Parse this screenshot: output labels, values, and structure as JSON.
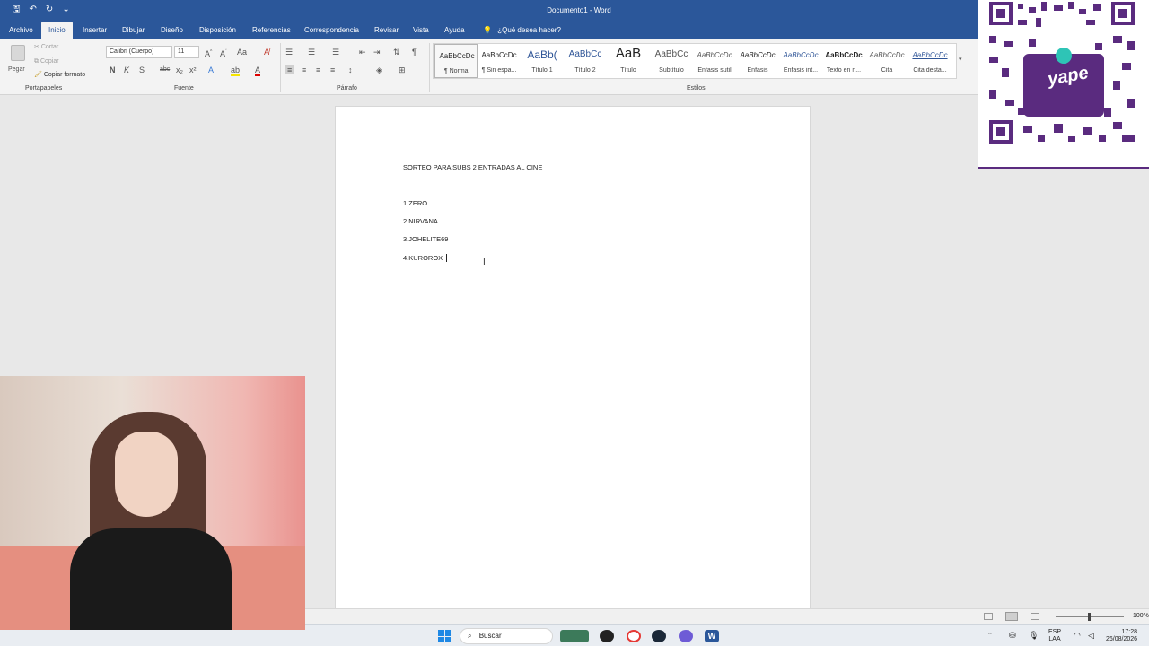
{
  "window": {
    "title": "Documento1 - Word"
  },
  "tabs": [
    {
      "label": "Archivo"
    },
    {
      "label": "Inicio"
    },
    {
      "label": "Insertar"
    },
    {
      "label": "Dibujar"
    },
    {
      "label": "Diseño"
    },
    {
      "label": "Disposición"
    },
    {
      "label": "Referencias"
    },
    {
      "label": "Correspondencia"
    },
    {
      "label": "Revisar"
    },
    {
      "label": "Vista"
    },
    {
      "label": "Ayuda"
    }
  ],
  "tell_me": "¿Qué desea hacer?",
  "clipboard": {
    "paste": "Pegar",
    "cut": "Cortar",
    "copy": "Copiar",
    "format_painter": "Copiar formato",
    "label": "Portapapeles"
  },
  "font": {
    "name": "Calibri (Cuerpo)",
    "size": "11",
    "bold": "N",
    "italic": "K",
    "underline": "S",
    "strike": "abc",
    "label": "Fuente"
  },
  "paragraph": {
    "label": "Párrafo"
  },
  "styles": {
    "label": "Estilos",
    "items": [
      {
        "sample": "AaBbCcDc",
        "name": "¶ Normal"
      },
      {
        "sample": "AaBbCcDc",
        "name": "¶ Sin espa..."
      },
      {
        "sample": "AaBb(",
        "name": "Título 1"
      },
      {
        "sample": "AaBbCc",
        "name": "Título 2"
      },
      {
        "sample": "AaB",
        "name": "Título"
      },
      {
        "sample": "AaBbCc",
        "name": "Subtítulo"
      },
      {
        "sample": "AaBbCcDc",
        "name": "Énfasis sutil"
      },
      {
        "sample": "AaBbCcDc",
        "name": "Énfasis"
      },
      {
        "sample": "AaBbCcDc",
        "name": "Énfasis int..."
      },
      {
        "sample": "AaBbCcDc",
        "name": "Texto en n..."
      },
      {
        "sample": "AaBbCcDc",
        "name": "Cita"
      },
      {
        "sample": "AaBbCcDc",
        "name": "Cita desta..."
      }
    ]
  },
  "document": {
    "heading": "SORTEO PARA SUBS 2 ENTRADAS AL CINE",
    "lines": [
      "1.ZERO",
      "2.NIRVANA",
      "3.JOHELITE69",
      "4.KUROROX"
    ]
  },
  "status": {
    "zoom": "100%"
  },
  "taskbar": {
    "search": "Buscar",
    "lang": "ESP",
    "lang2": "LAA",
    "time": "17:28",
    "date": "26/08/2026"
  },
  "overlay": {
    "qr_brand": "yape"
  },
  "colors": {
    "word_blue": "#2b579a",
    "qr_purple": "#5a2b7f"
  }
}
